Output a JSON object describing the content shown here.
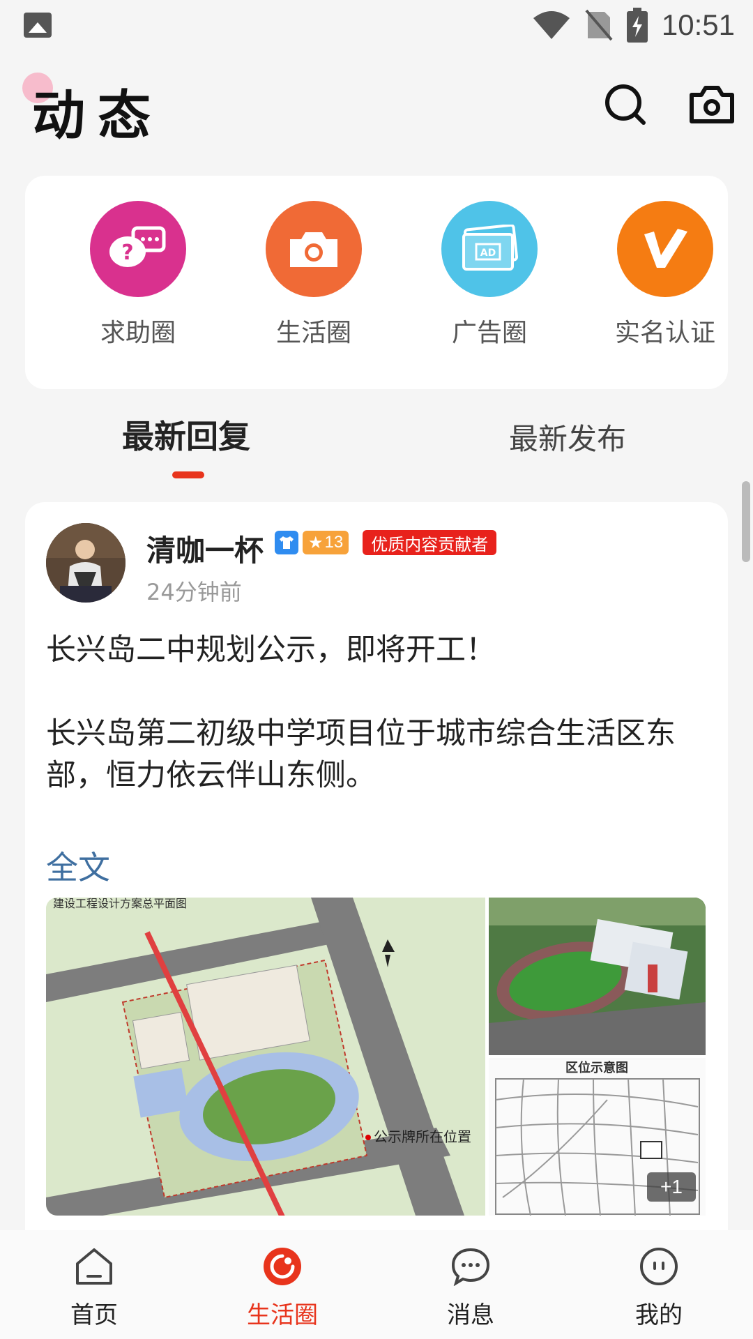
{
  "status_bar": {
    "time": "10:51"
  },
  "header": {
    "title": "动态"
  },
  "quick_links": [
    {
      "label": "求助圈",
      "color": "#d9318e",
      "icon": "help-chat-icon"
    },
    {
      "label": "生活圈",
      "color": "#f06a36",
      "icon": "camera-icon"
    },
    {
      "label": "广告圈",
      "color": "#4fc3e8",
      "icon": "ad-icon"
    },
    {
      "label": "实名认证",
      "color": "#f57c12",
      "icon": "verified-v-icon"
    }
  ],
  "tabs": {
    "active": "最新回复",
    "inactive": "最新发布"
  },
  "post": {
    "author": "清咖一杯",
    "level": "13",
    "contributor_badge": "优质内容贡献者",
    "time": "24分钟前",
    "paragraphs": [
      "长兴岛二中规划公示，即将开工！",
      "长兴岛第二初级中学项目位于城市综合生活区东部，恒力依云伴山东侧。"
    ],
    "fulltext_link": "全文",
    "images": {
      "main_caption": "建设工程设计方案总平面图",
      "main_annotation": "公示牌所在位置",
      "map_caption": "区位示意图",
      "more_count": "+1"
    }
  },
  "bottom_nav": [
    {
      "label": "首页",
      "icon": "home-icon",
      "active": false
    },
    {
      "label": "生活圈",
      "icon": "life-circle-icon",
      "active": true
    },
    {
      "label": "消息",
      "icon": "message-icon",
      "active": false
    },
    {
      "label": "我的",
      "icon": "profile-icon",
      "active": false
    }
  ],
  "colors": {
    "accent": "#e8341c",
    "link": "#3f6fa0"
  }
}
